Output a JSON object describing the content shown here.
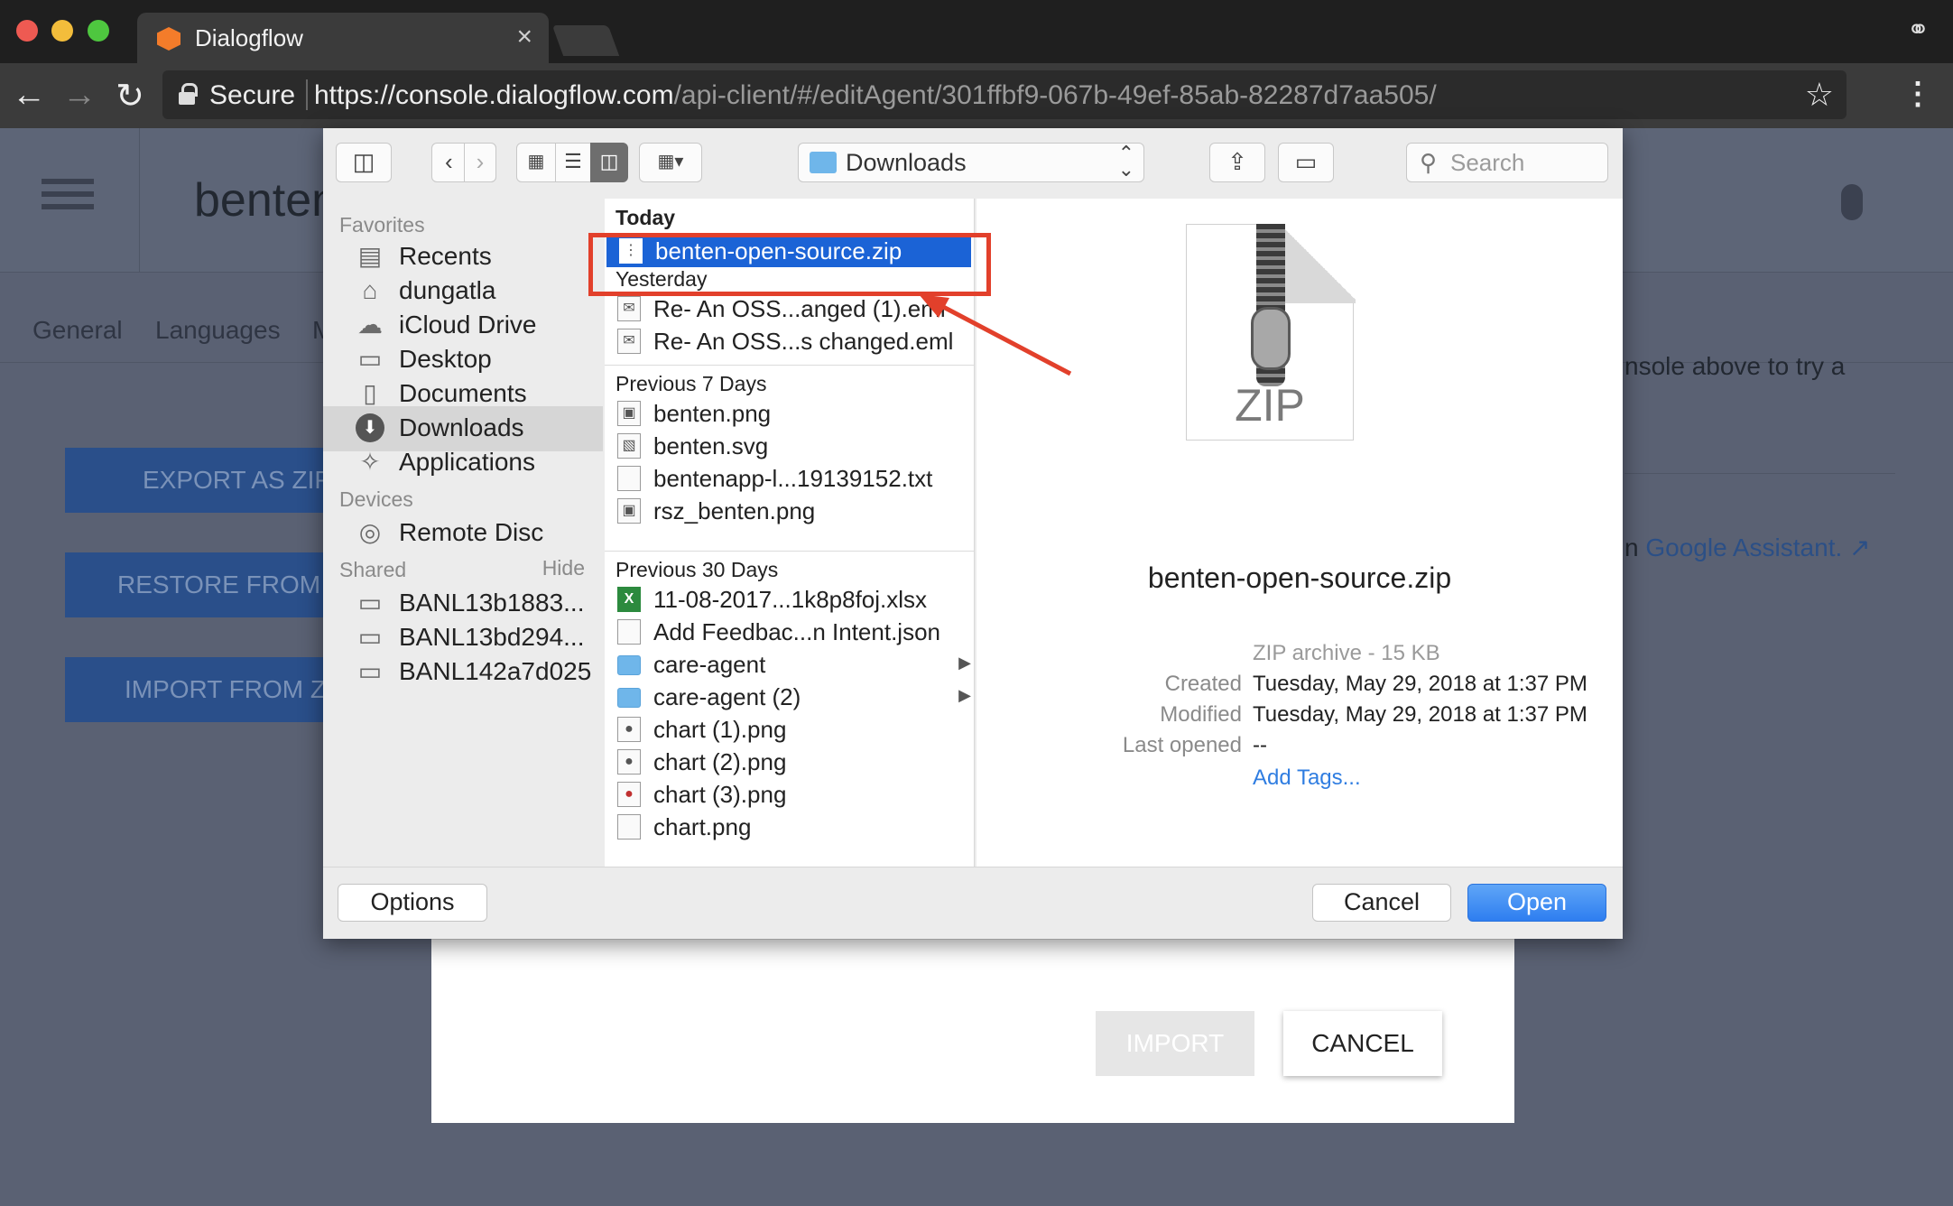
{
  "browser": {
    "tab_title": "Dialogflow",
    "tab_close": "×",
    "secure_label": "Secure",
    "url_host": "https://console.dialogflow.com",
    "url_path": "/api-client/#/editAgent/301ffbf9-067b-49ef-85ab-82287d7aa505/",
    "icons": [
      "back-icon",
      "forward-icon",
      "reload-icon",
      "lock-icon",
      "star-icon",
      "menu-icon",
      "incognito-icon"
    ]
  },
  "page": {
    "agent_title": "benten",
    "tabs": [
      "General",
      "Languages",
      "M"
    ],
    "buttons": [
      "EXPORT AS ZIP",
      "RESTORE FROM Z",
      "IMPORT FROM ZI"
    ],
    "right_text": "nsole above to try a",
    "right_link_prefix": "n ",
    "right_link": "Google Assistant.",
    "import_label": "IMPORT",
    "cancel_label": "CANCEL"
  },
  "dialog": {
    "location": "Downloads",
    "search_placeholder": "Search",
    "sidebar": {
      "favorites_label": "Favorites",
      "favorites": [
        {
          "label": "Recents",
          "icon": "recents-icon",
          "glyph": "▤"
        },
        {
          "label": "dungatla",
          "icon": "home-icon",
          "glyph": "⌂"
        },
        {
          "label": "iCloud Drive",
          "icon": "cloud-icon",
          "glyph": "☁"
        },
        {
          "label": "Desktop",
          "icon": "desktop-icon",
          "glyph": "▭"
        },
        {
          "label": "Documents",
          "icon": "documents-icon",
          "glyph": "▯"
        },
        {
          "label": "Downloads",
          "icon": "downloads-icon",
          "glyph": "⬇"
        },
        {
          "label": "Applications",
          "icon": "applications-icon",
          "glyph": "✧"
        }
      ],
      "devices_label": "Devices",
      "devices": [
        {
          "label": "Remote Disc",
          "icon": "disc-icon",
          "glyph": "◎"
        }
      ],
      "shared_label": "Shared",
      "hide_label": "Hide",
      "shared": [
        {
          "label": "BANL13b1883...",
          "icon": "computer-icon",
          "glyph": "▭"
        },
        {
          "label": "BANL13bd294...",
          "icon": "computer-icon",
          "glyph": "▭"
        },
        {
          "label": "BANL142a7d025",
          "icon": "computer-icon",
          "glyph": "▭"
        }
      ]
    },
    "groups": {
      "today": "Today",
      "yesterday": "Yesterday",
      "prev7": "Previous 7 Days",
      "prev30": "Previous 30 Days"
    },
    "files": {
      "today": [
        "benten-open-source.zip"
      ],
      "yesterday": [
        "Re- An OSS...anged (1).eml",
        "Re- An OSS...s changed.eml"
      ],
      "prev7": [
        "benten.png",
        "benten.svg",
        "bentenapp-l...19139152.txt",
        "rsz_benten.png"
      ],
      "prev30": [
        "11-08-2017...1k8p8foj.xlsx",
        "Add Feedbac...n Intent.json",
        "care-agent",
        "care-agent (2)",
        "chart (1).png",
        "chart (2).png",
        "chart (3).png",
        "chart.png"
      ]
    },
    "preview": {
      "icon_text": "ZIP",
      "name": "benten-open-source.zip",
      "kind": "ZIP archive - 15 KB",
      "created_label": "Created",
      "created": "Tuesday, May 29, 2018 at 1:37 PM",
      "modified_label": "Modified",
      "modified": "Tuesday, May 29, 2018 at 1:37 PM",
      "opened_label": "Last opened",
      "opened": "--",
      "add_tags": "Add Tags..."
    },
    "buttons": {
      "options": "Options",
      "cancel": "Cancel",
      "open": "Open"
    }
  },
  "colors": {
    "selection": "#1b63d6",
    "annotation": "#e2402b",
    "open_button": "#2e7ef0"
  }
}
